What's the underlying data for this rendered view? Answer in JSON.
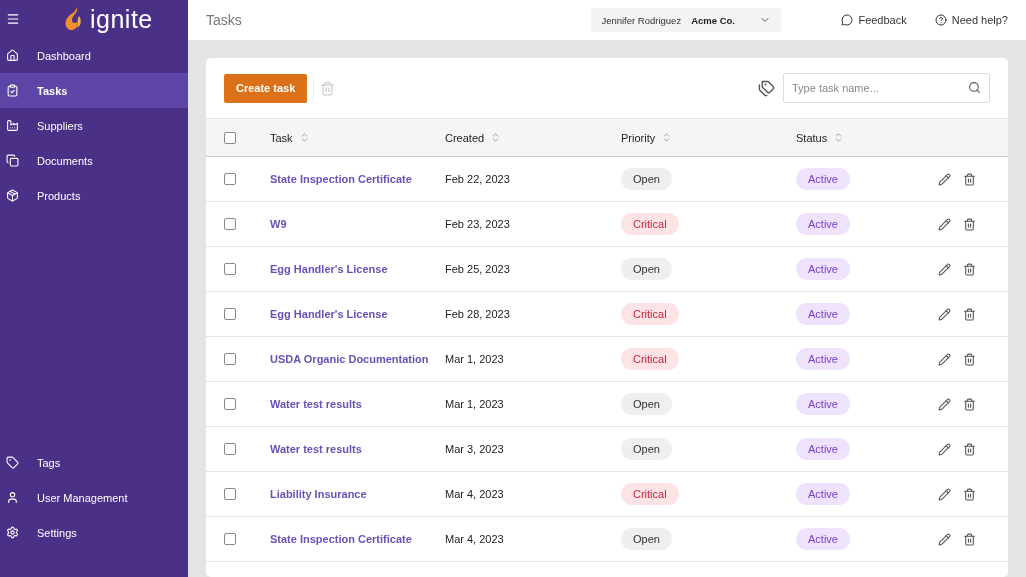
{
  "logo": {
    "text": "ignite"
  },
  "sidebar": {
    "items": [
      {
        "label": "Dashboard",
        "selected": false
      },
      {
        "label": "Tasks",
        "selected": true
      },
      {
        "label": "Suppliers",
        "selected": false
      },
      {
        "label": "Documents",
        "selected": false
      },
      {
        "label": "Products",
        "selected": false
      }
    ],
    "bottom_items": [
      {
        "label": "Tags",
        "selected": false
      },
      {
        "label": "User Management",
        "selected": false
      },
      {
        "label": "Settings",
        "selected": false
      }
    ]
  },
  "header": {
    "title": "Tasks",
    "user": "Jennifer Rodriguez",
    "company": "Acme Co.",
    "feedback": "Feedback",
    "help": "Need help?"
  },
  "toolbar": {
    "create_button": "Create task",
    "search": {
      "placeholder": "Type task name..."
    }
  },
  "table": {
    "select_all_checked": false,
    "columns": [
      "Task",
      "Created",
      "Priority",
      "Status"
    ],
    "rows": [
      {
        "task": "State Inspection Certificate",
        "created": "Feb 22, 2023",
        "priority": {
          "text": "Open",
          "kind": "open"
        },
        "status": "Active",
        "checked": false
      },
      {
        "task": "W9",
        "created": "Feb 23, 2023",
        "priority": {
          "text": "Critical",
          "kind": "critical"
        },
        "status": "Active",
        "checked": false
      },
      {
        "task": "Egg Handler's License",
        "created": "Feb 25, 2023",
        "priority": {
          "text": "Open",
          "kind": "open"
        },
        "status": "Active",
        "checked": false
      },
      {
        "task": "Egg Handler's License",
        "created": "Feb 28, 2023",
        "priority": {
          "text": "Critical",
          "kind": "critical"
        },
        "status": "Active",
        "checked": false
      },
      {
        "task": "USDA Organic Documentation",
        "created": "Mar 1, 2023",
        "priority": {
          "text": "Critical",
          "kind": "critical"
        },
        "status": "Active",
        "checked": false
      },
      {
        "task": "Water test results",
        "created": "Mar 1, 2023",
        "priority": {
          "text": "Open",
          "kind": "open"
        },
        "status": "Active",
        "checked": false
      },
      {
        "task": "Water test results",
        "created": "Mar 3, 2023",
        "priority": {
          "text": "Open",
          "kind": "open"
        },
        "status": "Active",
        "checked": false
      },
      {
        "task": "Liability Insurance",
        "created": "Mar 4, 2023",
        "priority": {
          "text": "Critical",
          "kind": "critical"
        },
        "status": "Active",
        "checked": false
      },
      {
        "task": "State Inspection Certificate",
        "created": "Mar 4, 2023",
        "priority": {
          "text": "Open",
          "kind": "open"
        },
        "status": "Active",
        "checked": false
      }
    ]
  }
}
